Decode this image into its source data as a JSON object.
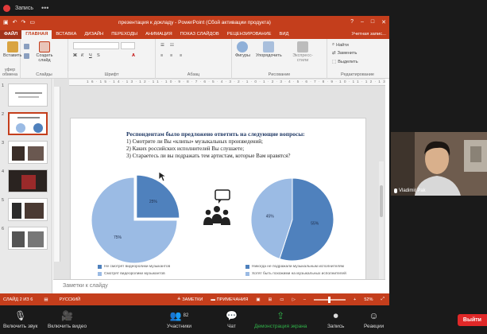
{
  "zoom": {
    "recording_label": "Запись",
    "bottom": {
      "audio": "Включить звук",
      "video": "Включить видео",
      "participants": "Участники",
      "participants_count": "82",
      "chat": "Чат",
      "share": "Демонстрация экрана",
      "record": "Запись",
      "reactions": "Реакции",
      "exit": "Выйти"
    }
  },
  "ppt": {
    "window_title": "презентация к докладу - PowerPoint (Сбой активации продукта)",
    "tabs": [
      "ФАЙЛ",
      "ГЛАВНАЯ",
      "ВСТАВКА",
      "ДИЗАЙН",
      "ПЕРЕХОДЫ",
      "АНИМАЦИЯ",
      "ПОКАЗ СЛАЙДОВ",
      "РЕЦЕНЗИРОВАНИЕ",
      "ВИД"
    ],
    "user": "Учетная запис...",
    "ribbon": {
      "paste": "Вставить",
      "clipboard": "уфер обмена",
      "new_slide": "Создать слайд",
      "slides": "Слайды",
      "font": "Шрифт",
      "paragraph": "Абзац",
      "shapes": "Фигуры",
      "arrange": "Упорядочить",
      "quick_styles": "Экспресс-стили",
      "drawing": "Рисование",
      "find": "Найти",
      "replace": "Заменить",
      "select": "Выделить",
      "editing": "Редактирование"
    },
    "ruler": "16·15·14·13·12·11·10·9·8·7·6·5·4·3·2·1·0·1·2·3·4·5·6·7·8·9·10·11·12·13·14·15·16",
    "thumb_numbers": [
      "1",
      "2",
      "3",
      "4",
      "5",
      "6"
    ],
    "notes_placeholder": "Заметки к слайду",
    "status": {
      "slide": "СЛАЙД 2 ИЗ 6",
      "language": "РУССКИЙ",
      "notes": "ЗАМЕТКИ",
      "comments": "ПРИМЕЧАНИЯ",
      "zoom": "52%"
    }
  },
  "slide": {
    "heading": "Респондентам было предложено ответить на следующие вопросы:",
    "questions": [
      "1)  Смотрите ли Вы «клипы» музыкальных произведений;",
      "2)  Каких российских исполнителей Вы слушаете;",
      "3)  Стараетесь ли вы подражать тем артистам, которые Вам нравятся?"
    ]
  },
  "video": {
    "name": "Vladimir Pak"
  },
  "chart_data": [
    {
      "type": "pie",
      "categories": [
        "Не смотрят видеоролики музыкантов",
        "Смотрят видеоролики музыкантов"
      ],
      "values": [
        25,
        75
      ],
      "data_labels": [
        "25%",
        "75%"
      ],
      "colors": [
        "#4f81bd",
        "#9bbbe4"
      ]
    },
    {
      "type": "pie",
      "categories": [
        "Никогда не подражали музыкальным исполнителям",
        "Хотят быть похожими на музыкальных исполнителей"
      ],
      "values": [
        55,
        45
      ],
      "data_labels": [
        "55%",
        "45%"
      ],
      "colors": [
        "#4f81bd",
        "#9bbbe4"
      ]
    }
  ]
}
